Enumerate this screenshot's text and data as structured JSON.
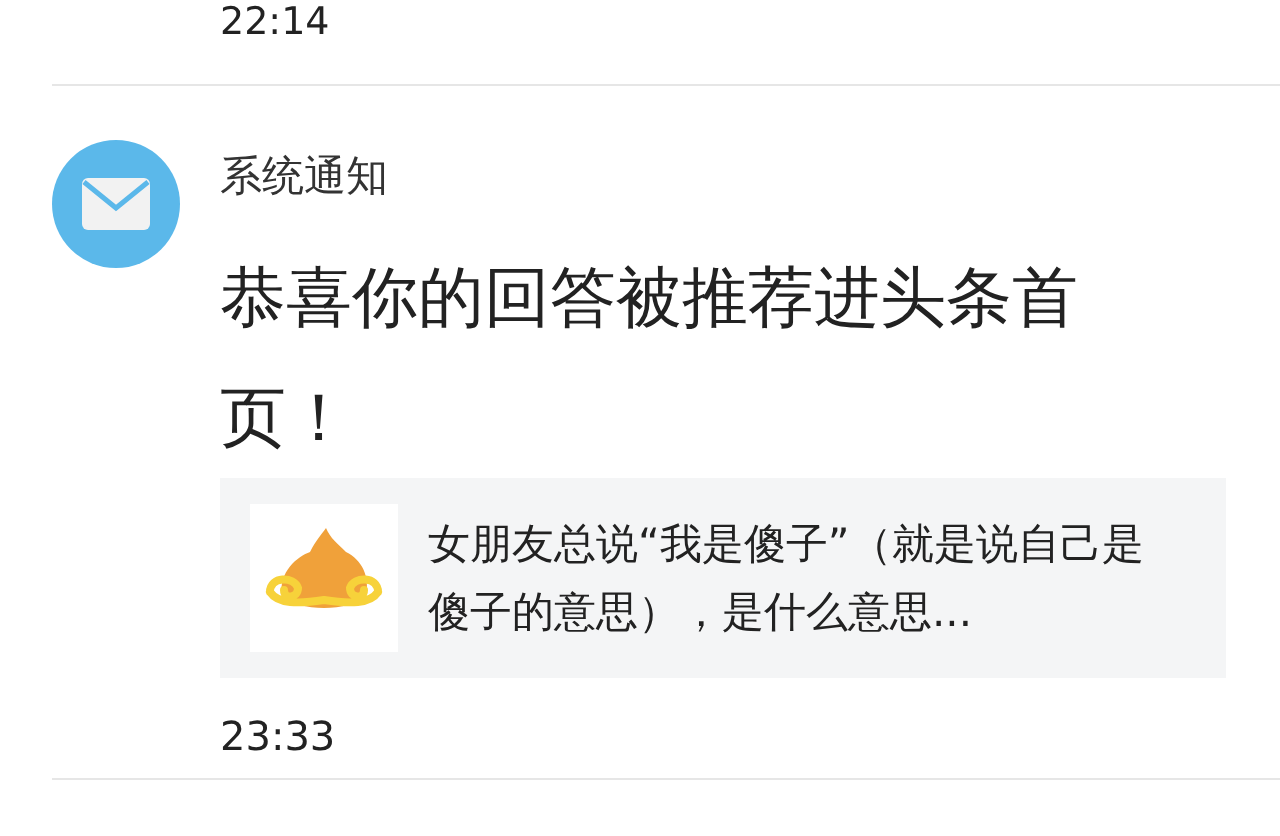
{
  "previous_message": {
    "time": "22:14"
  },
  "notification": {
    "sender": "系统通知",
    "message": "恭喜你的回答被推荐进头条首页！",
    "card": {
      "text": "女朋友总说“我是傻子”（就是说自己是傻子的意思），是什么意思..."
    },
    "time": "23:33"
  }
}
